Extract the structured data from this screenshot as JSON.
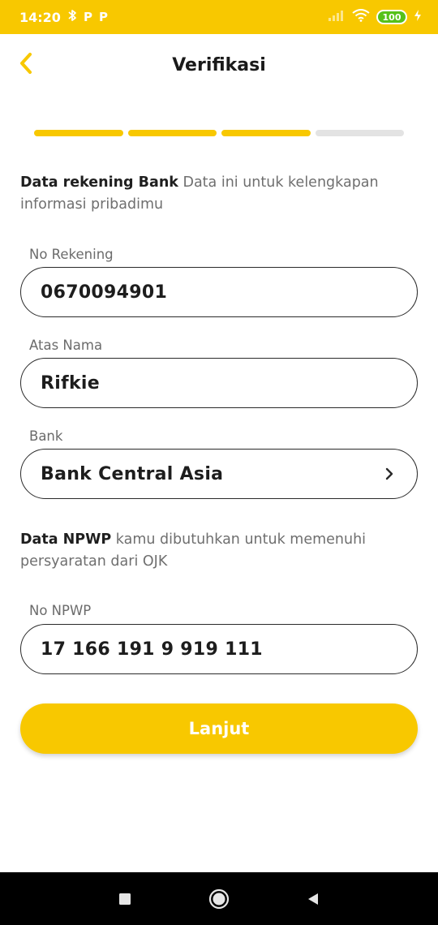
{
  "status_bar": {
    "time": "14:20",
    "icons": [
      "bluetooth-icon",
      "parking-icon",
      "parking-icon",
      "signal-icon",
      "wifi-icon",
      "battery-icon",
      "charging-icon"
    ],
    "notif_letters": [
      "P",
      "P"
    ],
    "battery_level": "100"
  },
  "header": {
    "title": "Verifikasi",
    "back_icon": "chevron-left-icon"
  },
  "progress": {
    "total_steps": 4,
    "completed_steps": 3
  },
  "bank_section": {
    "intro_bold": "Data rekening Bank",
    "intro_text": " Data ini untuk kelengkapan informasi pribadimu"
  },
  "fields": {
    "account_number": {
      "label": "No Rekening",
      "value": "0670094901"
    },
    "account_name": {
      "label": "Atas Nama",
      "value": "Rifkie"
    },
    "bank": {
      "label": "Bank",
      "value": "Bank Central Asia",
      "icon": "chevron-right-icon"
    },
    "npwp": {
      "label": "No NPWP",
      "value": "17 166 191 9 919 111"
    }
  },
  "npwp_section": {
    "intro_bold": "Data NPWP",
    "intro_text": " kamu dibutuhkan untuk memenuhi persyaratan dari OJK"
  },
  "actions": {
    "continue_label": "Lanjut"
  },
  "nav_bar": {
    "icons": [
      "recent-apps-icon",
      "home-icon",
      "back-triangle-icon"
    ]
  },
  "colors": {
    "accent": "#f8c800",
    "battery": "#56c11a"
  }
}
